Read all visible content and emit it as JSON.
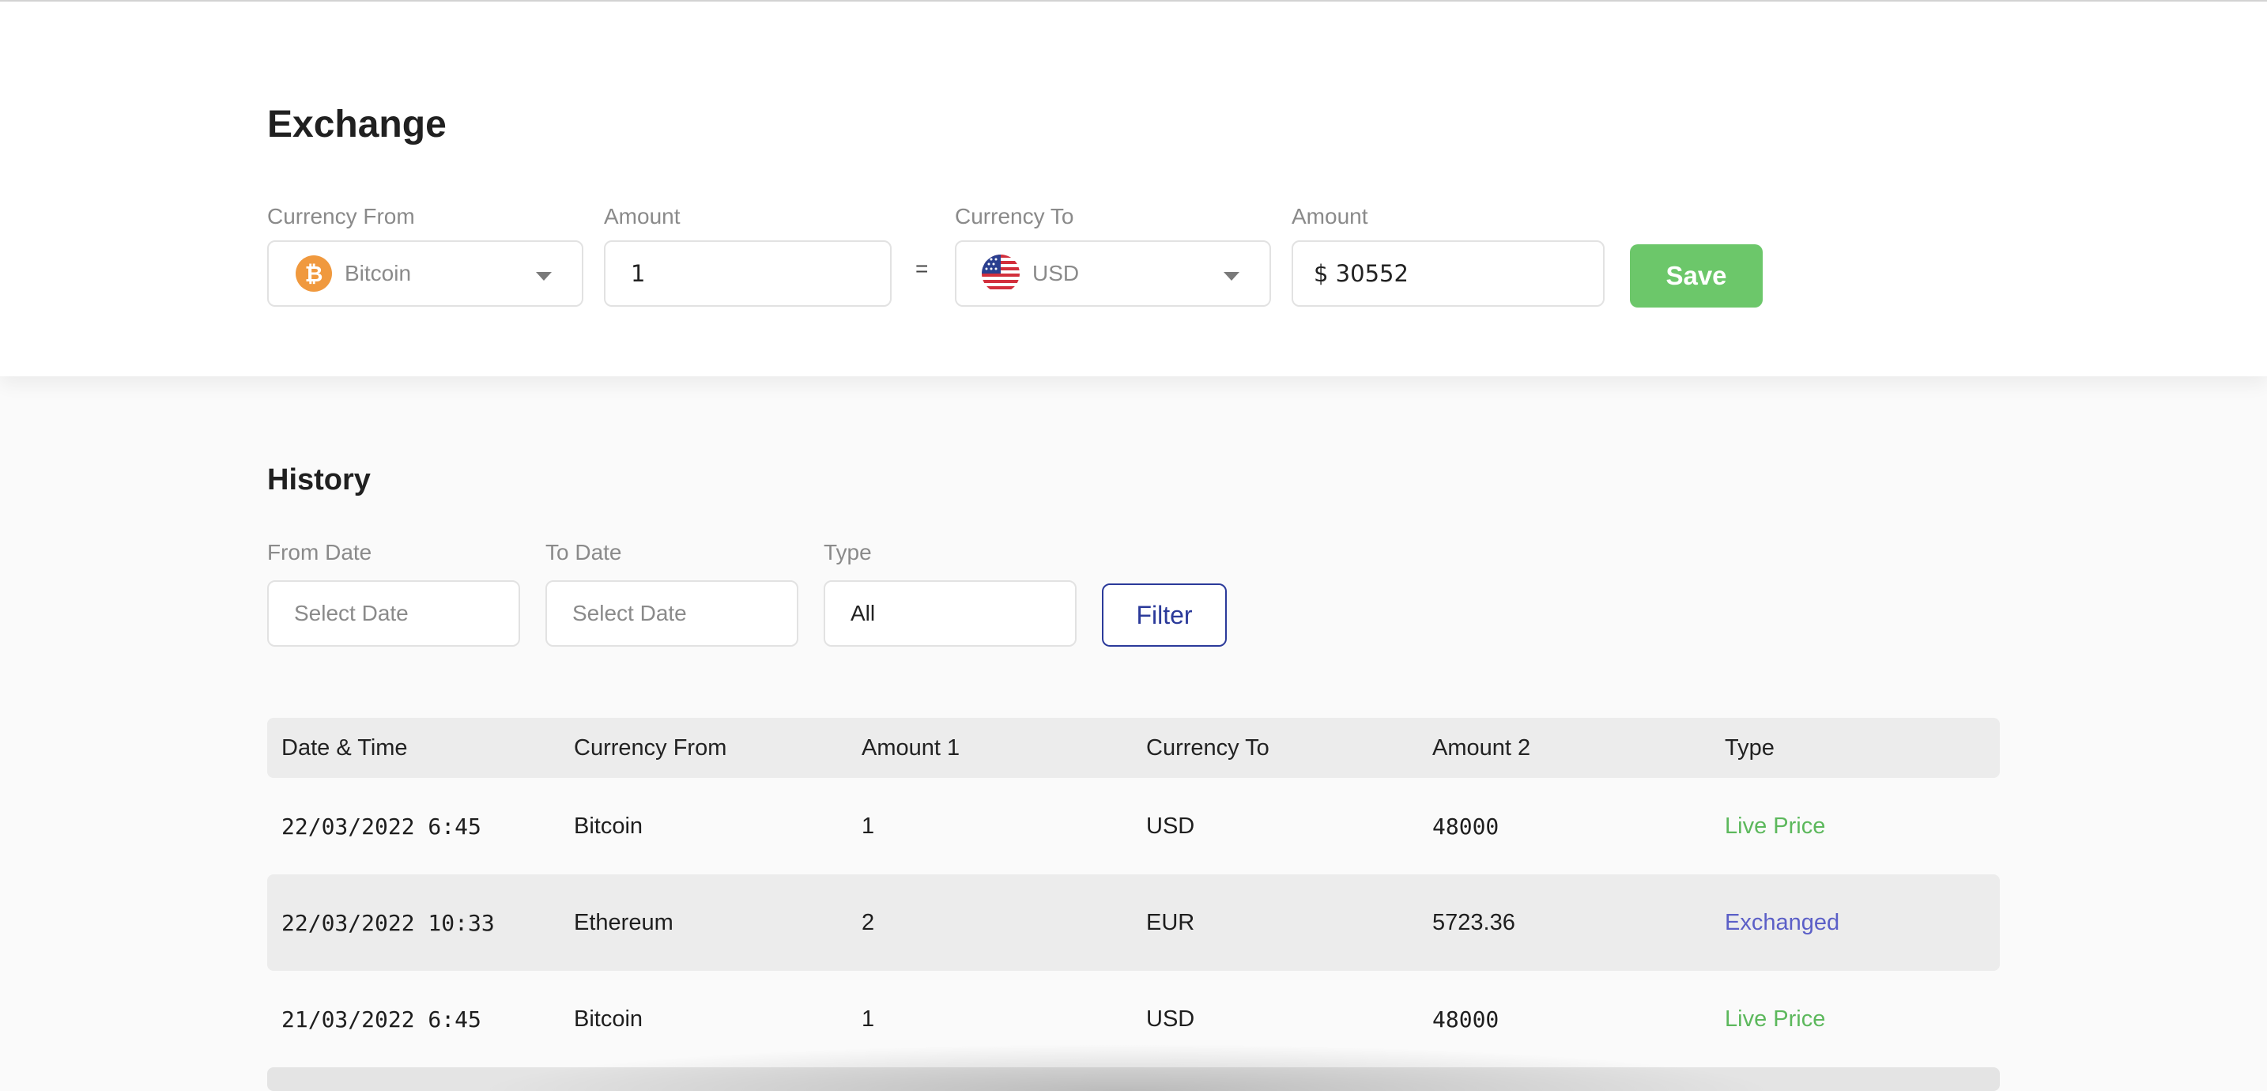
{
  "exchange": {
    "title": "Exchange",
    "currency_from_label": "Currency From",
    "currency_from_value": "Bitcoin",
    "currency_from_icon": "bitcoin-icon",
    "amount_from_label": "Amount",
    "amount_from_value": "1",
    "equals": "=",
    "currency_to_label": "Currency To",
    "currency_to_value": "USD",
    "currency_to_icon": "us-flag-icon",
    "amount_to_label": "Amount",
    "amount_to_value": "$ 30552",
    "save_label": "Save",
    "accent_color": "#6cc76a"
  },
  "history": {
    "title": "History",
    "from_date_label": "From Date",
    "from_date_placeholder": "Select Date",
    "to_date_label": "To Date",
    "to_date_placeholder": "Select Date",
    "type_label": "Type",
    "type_value": "All",
    "filter_label": "Filter",
    "table": {
      "columns": [
        "Date & Time",
        "Currency From",
        "Amount 1",
        "Currency To",
        "Amount 2",
        "Type"
      ],
      "rows": [
        {
          "datetime": "22/03/2022 6:45",
          "currency_from": "Bitcoin",
          "amount1": "1",
          "currency_to": "USD",
          "amount2": "48000",
          "type": "Live Price"
        },
        {
          "datetime": "22/03/2022 10:33",
          "currency_from": "Ethereum",
          "amount1": "2",
          "currency_to": "EUR",
          "amount2": "5723.36",
          "type": "Exchanged"
        },
        {
          "datetime": "21/03/2022 6:45",
          "currency_from": "Bitcoin",
          "amount1": "1",
          "currency_to": "USD",
          "amount2": "48000",
          "type": "Live Price"
        }
      ]
    },
    "type_colors": {
      "Live Price": "#5cb85c",
      "Exchanged": "#5b5fc7"
    }
  }
}
